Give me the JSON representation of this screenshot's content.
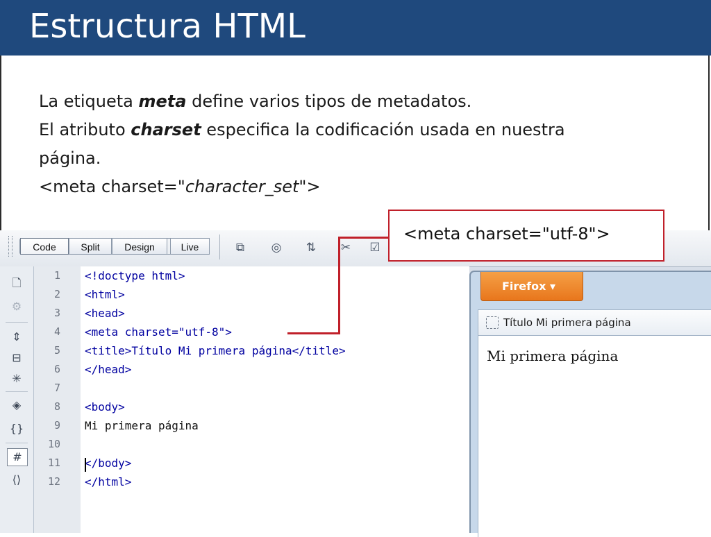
{
  "slide": {
    "title": "Estructura HTML",
    "lines": [
      {
        "before": "La etiqueta ",
        "emphasis": "meta",
        "after": " define varios tipos de metadatos."
      },
      {
        "before": "El atributo ",
        "emphasis": "charset",
        "after": " especifica la codificación usada en nuestra"
      },
      {
        "before": "página.",
        "emphasis": "",
        "after": ""
      },
      {
        "before": "<meta charset=\"",
        "italic": "character_set",
        "after": "\">"
      }
    ]
  },
  "editor": {
    "toolbar": {
      "view_buttons": [
        "Code",
        "Split",
        "Design",
        "Live"
      ],
      "active_view": "Code",
      "icons": [
        "multiscreen-icon",
        "browser-preview-icon",
        "file-transfer-icon",
        "debug-icon",
        "validate-icon"
      ]
    },
    "rail_icons": [
      "document-icon",
      "gear-icon",
      "collapse-tag-icon",
      "collapse-selection-icon",
      "expand-all-icon",
      "select-parent-icon",
      "balance-braces-icon",
      "line-numbers-icon",
      "comment-icon"
    ],
    "code_lines": [
      {
        "n": "1",
        "text": "<!doctype html>",
        "kind": "tag"
      },
      {
        "n": "2",
        "text": "<html>",
        "kind": "tag"
      },
      {
        "n": "3",
        "text": "<head>",
        "kind": "tag"
      },
      {
        "n": "4",
        "text": "<meta charset=\"utf-8\">",
        "kind": "tag"
      },
      {
        "n": "5",
        "text": "<title>Título Mi primera página</title>",
        "kind": "tag"
      },
      {
        "n": "6",
        "text": "</head>",
        "kind": "tag"
      },
      {
        "n": "7",
        "text": "",
        "kind": "tag"
      },
      {
        "n": "8",
        "text": "<body>",
        "kind": "tag"
      },
      {
        "n": "9",
        "text": "Mi primera página",
        "kind": "text"
      },
      {
        "n": "10",
        "text": "",
        "kind": "tag"
      },
      {
        "n": "11",
        "text": "</body>",
        "kind": "tag"
      },
      {
        "n": "12",
        "text": "</html>",
        "kind": "tag"
      }
    ]
  },
  "browser": {
    "menu_button": "Firefox ▾",
    "tab_title": "Título Mi primera página",
    "page_text": "Mi primera página"
  },
  "callout": {
    "text": "<meta charset=\"utf-8\">"
  },
  "colors": {
    "title_bar": "#1f497d",
    "callout_border": "#c0202a",
    "code_tag": "#0000a0",
    "firefox_orange": "#e8761c"
  }
}
